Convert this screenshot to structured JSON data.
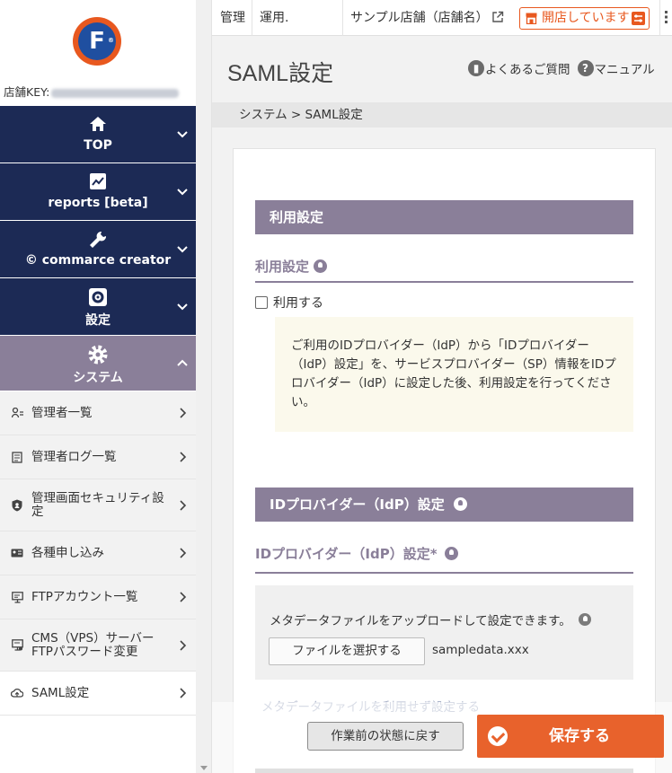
{
  "sidebar": {
    "store_key_label": "店舗KEY:",
    "menu": [
      {
        "label": "TOP",
        "icon": "home-icon"
      },
      {
        "label": "reports [beta]",
        "icon": "chart-line-icon"
      },
      {
        "label": "commarce creator",
        "icon": "wrench-icon"
      },
      {
        "label": "設定",
        "icon": "gear-icon"
      },
      {
        "label": "システム",
        "icon": "gear-icon"
      }
    ],
    "submenu": [
      {
        "label": "管理者一覧",
        "icon": "user-list-icon"
      },
      {
        "label": "管理者ログ一覧",
        "icon": "log-icon"
      },
      {
        "label": "管理画面セキュリティ設定",
        "icon": "shield-icon"
      },
      {
        "label": "各種申し込み",
        "icon": "id-card-icon"
      },
      {
        "label": "FTPアカウント一覧",
        "icon": "monitor-icon"
      },
      {
        "label": "CMS（VPS）サーバー FTPパスワード変更",
        "icon": "server-icon"
      },
      {
        "label": "SAML設定",
        "icon": "cloud-upload-icon"
      }
    ]
  },
  "topbar": {
    "manage_label": "管理",
    "operation_label": "運用.",
    "store_name": "サンプル店舗（店舗名）",
    "open_status": "開店しています"
  },
  "header": {
    "title": "SAML設定",
    "faq_label": "よくあるご質問",
    "manual_label": "マニュアル",
    "breadcrumb": "システム > SAML設定"
  },
  "usage_section": {
    "header": "利用設定",
    "subheading": "利用設定",
    "checkbox_label": "利用する",
    "notice": "ご利用のIDプロバイダー（IdP）から「IDプロバイダー（IdP）設定」を、サービスプロバイダー（SP）情報をIDプロバイダー（IdP）に設定した後、利用設定を行ってください。"
  },
  "idp_section": {
    "header": "IDプロバイダー（IdP）設定",
    "subheading": "IDプロバイダー（IdP）設定*",
    "upload_text": "メタデータファイルをアップロードして設定できます。",
    "file_button": "ファイルを選択する",
    "file_name": "sampledata.xxx",
    "no_metadata_link": "メタデータファイルを利用せず設定する"
  },
  "actions": {
    "reset_label": "作業前の状態に戻す",
    "save_label": "保存する"
  },
  "colors": {
    "navy": "#1c2a55",
    "purple_gray": "#8a7f99",
    "accent_orange": "#e8581f"
  }
}
